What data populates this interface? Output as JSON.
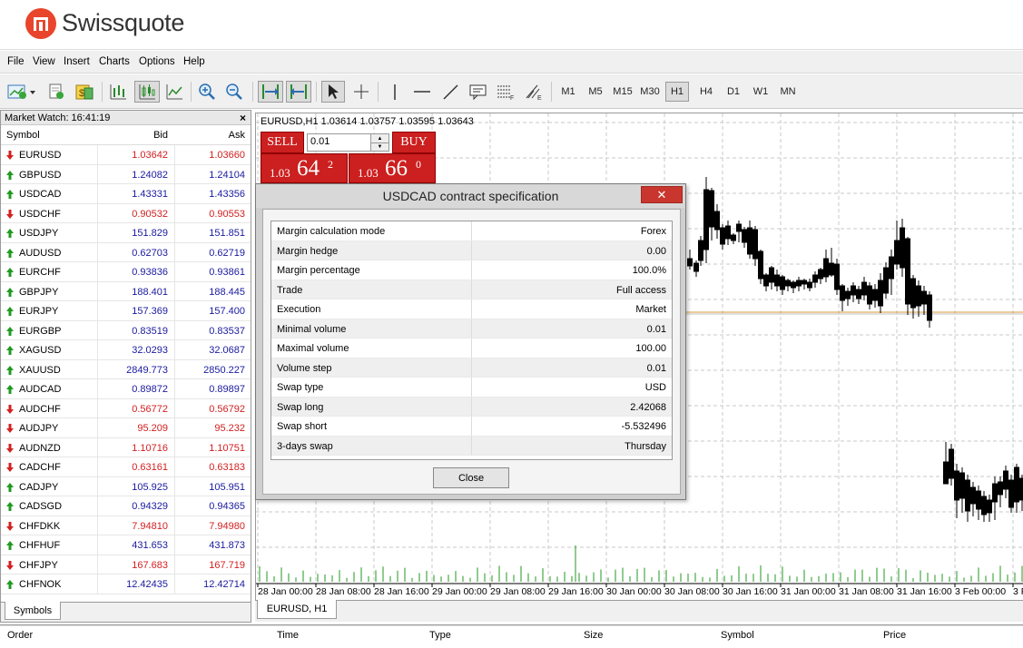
{
  "brand": {
    "name": "Swissquote",
    "color": "#e8452c"
  },
  "menu": [
    "File",
    "View",
    "Insert",
    "Charts",
    "Options",
    "Help"
  ],
  "timeframes": [
    {
      "label": "M1",
      "active": false
    },
    {
      "label": "M5",
      "active": false
    },
    {
      "label": "M15",
      "active": false
    },
    {
      "label": "M30",
      "active": false
    },
    {
      "label": "H1",
      "active": true
    },
    {
      "label": "H4",
      "active": false
    },
    {
      "label": "D1",
      "active": false
    },
    {
      "label": "W1",
      "active": false
    },
    {
      "label": "MN",
      "active": false
    }
  ],
  "toolbar_icons": [
    "new-chart-icon",
    "profiles-icon",
    "market-watch-icon",
    "bar-chart-icon",
    "candlestick-icon",
    "line-chart-icon",
    "zoom-in-icon",
    "zoom-out-icon",
    "autoscroll-icon",
    "chart-shift-icon",
    "cursor-icon",
    "crosshair-icon",
    "vertical-line-icon",
    "horizontal-line-icon",
    "trendline-icon",
    "text-icon",
    "fibonacci-icon",
    "objects-icon"
  ],
  "market_watch": {
    "title": "Market Watch: 16:41:19",
    "headers": {
      "symbol": "Symbol",
      "bid": "Bid",
      "ask": "Ask"
    },
    "rows": [
      {
        "symbol": "EURUSD",
        "bid": "1.03642",
        "ask": "1.03660",
        "dir": "down"
      },
      {
        "symbol": "GBPUSD",
        "bid": "1.24082",
        "ask": "1.24104",
        "dir": "up"
      },
      {
        "symbol": "USDCAD",
        "bid": "1.43331",
        "ask": "1.43356",
        "dir": "up"
      },
      {
        "symbol": "USDCHF",
        "bid": "0.90532",
        "ask": "0.90553",
        "dir": "down"
      },
      {
        "symbol": "USDJPY",
        "bid": "151.829",
        "ask": "151.851",
        "dir": "up"
      },
      {
        "symbol": "AUDUSD",
        "bid": "0.62703",
        "ask": "0.62719",
        "dir": "up"
      },
      {
        "symbol": "EURCHF",
        "bid": "0.93836",
        "ask": "0.93861",
        "dir": "up"
      },
      {
        "symbol": "GBPJPY",
        "bid": "188.401",
        "ask": "188.445",
        "dir": "up"
      },
      {
        "symbol": "EURJPY",
        "bid": "157.369",
        "ask": "157.400",
        "dir": "up"
      },
      {
        "symbol": "EURGBP",
        "bid": "0.83519",
        "ask": "0.83537",
        "dir": "up"
      },
      {
        "symbol": "XAGUSD",
        "bid": "32.0293",
        "ask": "32.0687",
        "dir": "up"
      },
      {
        "symbol": "XAUUSD",
        "bid": "2849.773",
        "ask": "2850.227",
        "dir": "up"
      },
      {
        "symbol": "AUDCAD",
        "bid": "0.89872",
        "ask": "0.89897",
        "dir": "up"
      },
      {
        "symbol": "AUDCHF",
        "bid": "0.56772",
        "ask": "0.56792",
        "dir": "down"
      },
      {
        "symbol": "AUDJPY",
        "bid": "95.209",
        "ask": "95.232",
        "dir": "down"
      },
      {
        "symbol": "AUDNZD",
        "bid": "1.10716",
        "ask": "1.10751",
        "dir": "down"
      },
      {
        "symbol": "CADCHF",
        "bid": "0.63161",
        "ask": "0.63183",
        "dir": "down"
      },
      {
        "symbol": "CADJPY",
        "bid": "105.925",
        "ask": "105.951",
        "dir": "up"
      },
      {
        "symbol": "CADSGD",
        "bid": "0.94329",
        "ask": "0.94365",
        "dir": "up"
      },
      {
        "symbol": "CHFDKK",
        "bid": "7.94810",
        "ask": "7.94980",
        "dir": "down"
      },
      {
        "symbol": "CHFHUF",
        "bid": "431.653",
        "ask": "431.873",
        "dir": "up"
      },
      {
        "symbol": "CHFJPY",
        "bid": "167.683",
        "ask": "167.719",
        "dir": "down"
      },
      {
        "symbol": "CHFNOK",
        "bid": "12.42435",
        "ask": "12.42714",
        "dir": "up"
      }
    ],
    "tab": "Symbols",
    "colors": {
      "up": "#1f9a1f",
      "down": "#d32020",
      "down_text": "#d32020",
      "up_text": "#1a1aa0"
    }
  },
  "chart": {
    "header": "EURUSD,H1  1.03614 1.03757 1.03595 1.03643",
    "tab": "EURUSD, H1",
    "time_labels": [
      "28 Jan 00:00",
      "28 Jan 08:00",
      "28 Jan 16:00",
      "29 Jan 00:00",
      "29 Jan 08:00",
      "29 Jan 16:00",
      "30 Jan 00:00",
      "30 Jan 08:00",
      "30 Jan 16:00",
      "31 Jan 00:00",
      "31 Jan 08:00",
      "31 Jan 16:00",
      "3 Feb 00:00",
      "3 F"
    ]
  },
  "one_click": {
    "sell": "SELL",
    "buy": "BUY",
    "volume": "0.01",
    "sell_price": {
      "small": "1.03",
      "big": "64",
      "sup": "2"
    },
    "buy_price": {
      "small": "1.03",
      "big": "66",
      "sup": "0"
    }
  },
  "dialog": {
    "title": "USDCAD contract specification",
    "close_label": "Close",
    "rows": [
      {
        "key": "Margin calculation mode",
        "value": "Forex"
      },
      {
        "key": "Margin hedge",
        "value": "0.00"
      },
      {
        "key": "Margin percentage",
        "value": "100.0%"
      },
      {
        "key": "Trade",
        "value": "Full access"
      },
      {
        "key": "Execution",
        "value": "Market"
      },
      {
        "key": "Minimal volume",
        "value": "0.01"
      },
      {
        "key": "Maximal volume",
        "value": "100.00"
      },
      {
        "key": "Volume step",
        "value": "0.01"
      },
      {
        "key": "Swap type",
        "value": "USD"
      },
      {
        "key": "Swap long",
        "value": "2.42068"
      },
      {
        "key": "Swap short",
        "value": "-5.532496"
      },
      {
        "key": "3-days swap",
        "value": "Thursday"
      }
    ]
  },
  "orders": {
    "headers": [
      "Order",
      "Time",
      "Type",
      "Size",
      "Symbol",
      "Price"
    ]
  }
}
